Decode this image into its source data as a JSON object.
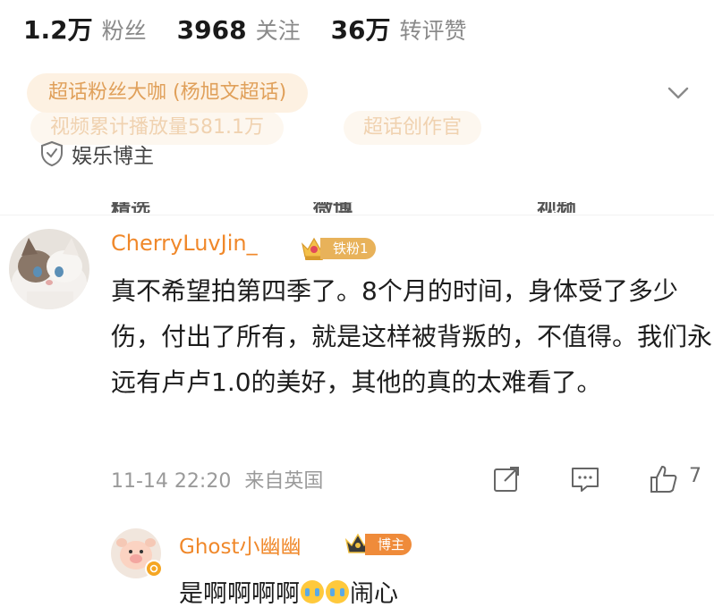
{
  "profile_stats": [
    {
      "value": "1.2万",
      "label": "粉丝"
    },
    {
      "value": "3968",
      "label": "关注"
    },
    {
      "value": "36万",
      "label": "转评赞"
    }
  ],
  "tags": {
    "main": "超话粉丝大咖 (杨旭文超话)",
    "faded_1": "视频累计播放量581.1万",
    "faded_2": "超话创作官"
  },
  "verified_label": "娱乐博主",
  "tabs": [
    "精选",
    "微博",
    "视频"
  ],
  "comment": {
    "username": "CherryLuvJin_",
    "fan_badge": "铁粉1",
    "text": "真不希望拍第四季了。8个月的时间，身体受了多少伤，付出了所有，就是这样被背叛的，不值得。我们永远有卢卢1.0的美好，其他的真的太难看了。",
    "timestamp": "11-14 22:20",
    "location": "来自英国",
    "likes": "7"
  },
  "reply": {
    "username": "Ghost小幽幽",
    "badge": "博主",
    "text_before": "是啊啊啊啊",
    "text_after": "闹心",
    "emoji": "crying-emoji"
  },
  "colors": {
    "accent_orange": "#f0882a",
    "chip_bg": "#fdf1e2",
    "chip_text": "#e0a05a",
    "badge_gold": "#e8b25a",
    "meta_gray": "#9a9a9a"
  }
}
